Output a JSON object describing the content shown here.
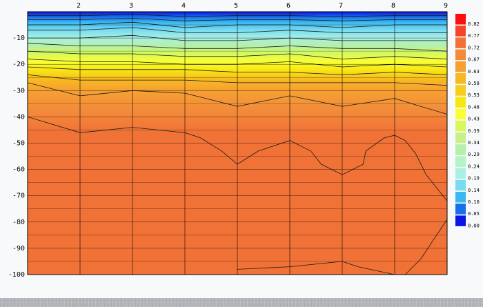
{
  "chart_data": {
    "type": "heatmap",
    "title": "",
    "xlabel": "",
    "ylabel": "",
    "x_ticks": [
      2,
      3,
      4,
      5,
      6,
      7,
      8,
      9
    ],
    "y_ticks": [
      -10,
      -20,
      -30,
      -40,
      -50,
      -60,
      -70,
      -80,
      -90,
      -100
    ],
    "xlim": [
      1,
      9
    ],
    "ylim": [
      -100,
      0
    ],
    "grid": true,
    "legend_placement": "right",
    "colorbar": {
      "labels": [
        "0.82",
        "0.77",
        "0.72",
        "0.67",
        "0.63",
        "0.58",
        "0.53",
        "0.48",
        "0.43",
        "0.39",
        "0.34",
        "0.29",
        "0.24",
        "0.19",
        "0.14",
        "0.10",
        "0.05",
        "0.00"
      ],
      "colors": [
        "#ff0c0c",
        "#f4452a",
        "#f07236",
        "#f38a3a",
        "#f6a032",
        "#f7b822",
        "#f7ce1a",
        "#f8e812",
        "#f8ff34",
        "#d8f85a",
        "#c8f08a",
        "#b4f0a8",
        "#b2f4c4",
        "#a8f0e4",
        "#78dcf0",
        "#3ab8f0",
        "#1870e8",
        "#0a14e8"
      ]
    },
    "contours": [
      {
        "level": 0.63,
        "points": [
          [
            1,
            -27
          ],
          [
            2,
            -32
          ],
          [
            3,
            -30
          ],
          [
            4,
            -31
          ],
          [
            5,
            -36
          ],
          [
            6,
            -32
          ],
          [
            7,
            -36
          ],
          [
            8,
            -33
          ],
          [
            8.5,
            -36
          ],
          [
            9,
            -39
          ]
        ]
      },
      {
        "level": 0.72,
        "points": [
          [
            1,
            -40
          ],
          [
            2,
            -46
          ],
          [
            3,
            -44
          ],
          [
            4,
            -46
          ],
          [
            4.3,
            -48
          ],
          [
            4.7,
            -53
          ],
          [
            5,
            -58
          ],
          [
            5.4,
            -53
          ],
          [
            6,
            -49
          ],
          [
            6.4,
            -53
          ],
          [
            6.6,
            -58
          ],
          [
            7,
            -62
          ],
          [
            7.4,
            -58
          ],
          [
            7.45,
            -53
          ],
          [
            7.8,
            -48
          ],
          [
            8,
            -47
          ],
          [
            8.2,
            -49
          ],
          [
            8.4,
            -54
          ],
          [
            8.6,
            -62
          ],
          [
            9,
            -72
          ]
        ]
      },
      {
        "level": 0.77,
        "points": [
          [
            9,
            -79
          ],
          [
            8.8,
            -85
          ],
          [
            8.5,
            -94
          ],
          [
            8.2,
            -100
          ]
        ]
      },
      {
        "level": 0.77,
        "points": [
          [
            5,
            -98
          ],
          [
            6,
            -97
          ],
          [
            7,
            -95
          ],
          [
            7.3,
            -97
          ],
          [
            8,
            -100
          ]
        ]
      },
      {
        "level": 0.48,
        "points": [
          [
            1,
            -24
          ],
          [
            2,
            -26
          ],
          [
            3,
            -26
          ],
          [
            4,
            -26
          ],
          [
            5,
            -27
          ],
          [
            6,
            -27
          ],
          [
            7,
            -27
          ],
          [
            8,
            -27
          ],
          [
            9,
            -28
          ]
        ]
      },
      {
        "level": 0.43,
        "points": [
          [
            1,
            -21
          ],
          [
            2,
            -22
          ],
          [
            3,
            -22
          ],
          [
            4,
            -22
          ],
          [
            5,
            -23
          ],
          [
            6,
            -23
          ],
          [
            7,
            -24
          ],
          [
            8,
            -23
          ],
          [
            9,
            -24
          ]
        ]
      },
      {
        "level": 0.39,
        "points": [
          [
            1,
            -18
          ],
          [
            2,
            -19
          ],
          [
            3,
            -19
          ],
          [
            4,
            -20
          ],
          [
            5,
            -20
          ],
          [
            6,
            -19
          ],
          [
            7,
            -21
          ],
          [
            8,
            -20
          ],
          [
            9,
            -21
          ]
        ]
      },
      {
        "level": 0.34,
        "points": [
          [
            1,
            -15
          ],
          [
            2,
            -16
          ],
          [
            3,
            -16
          ],
          [
            4,
            -17
          ],
          [
            5,
            -17
          ],
          [
            6,
            -16
          ],
          [
            7,
            -18
          ],
          [
            8,
            -17
          ],
          [
            9,
            -18
          ]
        ]
      },
      {
        "level": 0.29,
        "points": [
          [
            1,
            -12
          ],
          [
            2,
            -13
          ],
          [
            3,
            -13
          ],
          [
            4,
            -14
          ],
          [
            5,
            -14
          ],
          [
            6,
            -13
          ],
          [
            7,
            -14
          ],
          [
            8,
            -14
          ],
          [
            9,
            -15
          ]
        ]
      },
      {
        "level": 0.24,
        "points": [
          [
            1,
            -10
          ],
          [
            2,
            -10
          ],
          [
            3,
            -9
          ],
          [
            4,
            -11
          ],
          [
            5,
            -11
          ],
          [
            6,
            -10
          ],
          [
            7,
            -11
          ],
          [
            8,
            -11
          ],
          [
            9,
            -11
          ]
        ]
      },
      {
        "level": 0.19,
        "points": [
          [
            1,
            -7
          ],
          [
            2,
            -7
          ],
          [
            3,
            -6
          ],
          [
            4,
            -8
          ],
          [
            5,
            -8
          ],
          [
            6,
            -7
          ],
          [
            7,
            -8
          ],
          [
            8,
            -8
          ],
          [
            9,
            -8
          ]
        ]
      },
      {
        "level": 0.14,
        "points": [
          [
            1,
            -5
          ],
          [
            2,
            -5
          ],
          [
            3,
            -4
          ],
          [
            4,
            -6
          ],
          [
            5,
            -5
          ],
          [
            6,
            -5
          ],
          [
            7,
            -6
          ],
          [
            8,
            -5
          ],
          [
            9,
            -5
          ]
        ]
      },
      {
        "level": 0.1,
        "points": [
          [
            1,
            -3
          ],
          [
            2,
            -3
          ],
          [
            3,
            -2.5
          ],
          [
            4,
            -3.5
          ],
          [
            5,
            -3
          ],
          [
            6,
            -3
          ],
          [
            7,
            -3.5
          ],
          [
            8,
            -3
          ],
          [
            9,
            -3
          ]
        ]
      },
      {
        "level": 0.05,
        "points": [
          [
            1,
            -1.5
          ],
          [
            2,
            -1.5
          ],
          [
            3,
            -1
          ],
          [
            4,
            -1.8
          ],
          [
            5,
            -1.5
          ],
          [
            6,
            -1.5
          ],
          [
            7,
            -1.8
          ],
          [
            8,
            -1.5
          ],
          [
            9,
            -1.5
          ]
        ]
      }
    ]
  }
}
